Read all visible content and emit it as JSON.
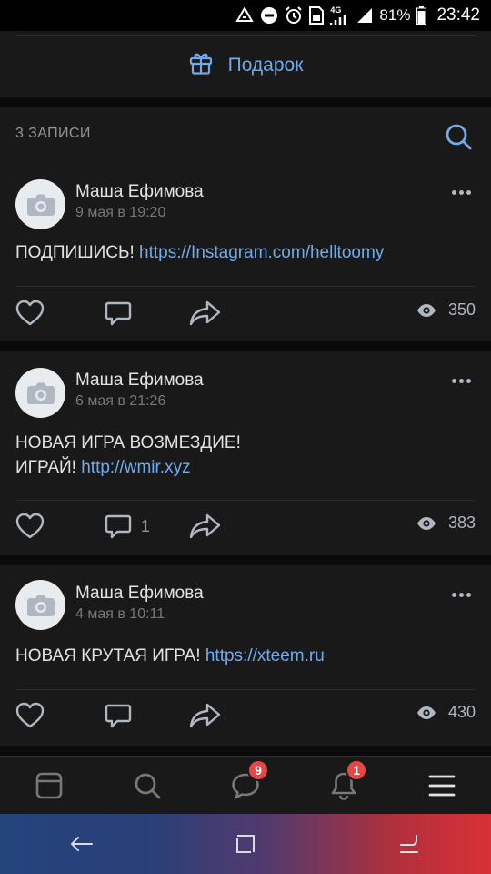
{
  "status_bar": {
    "battery_percent": "81%",
    "time": "23:42",
    "network": "4G",
    "icons": [
      "recycle-icon",
      "do-not-disturb-icon",
      "alarm-icon",
      "sim-icon",
      "signal-icon",
      "battery-icon"
    ]
  },
  "gift": {
    "label": "Подарок",
    "icon": "gift-icon"
  },
  "records": {
    "title": "3 ЗАПИСИ",
    "search_icon": "search-icon"
  },
  "posts": [
    {
      "author": "Маша Ефимова",
      "date": "9 мая в 19:20",
      "text_lines": [
        {
          "prefix": "ПОДПИШИСЬ! ",
          "link": "https://Instagram.com/helltoomy"
        }
      ],
      "comments": "",
      "views": "350"
    },
    {
      "author": "Маша Ефимова",
      "date": "6 мая в 21:26",
      "text_lines": [
        {
          "prefix": "НОВАЯ ИГРА ВОЗМЕЗДИЕ!",
          "link": ""
        },
        {
          "prefix": "ИГРАЙ! ",
          "link": "http://wmir.xyz"
        }
      ],
      "comments": "1",
      "views": "383"
    },
    {
      "author": "Маша Ефимова",
      "date": "4 мая в 10:11",
      "text_lines": [
        {
          "prefix": "НОВАЯ КРУТАЯ ИГРА! ",
          "link": "https://xteem.ru"
        }
      ],
      "comments": "",
      "views": "430"
    }
  ],
  "bottom_nav": {
    "messages_badge": "9",
    "notifications_badge": "1",
    "items": [
      "news-icon",
      "search-icon",
      "messages-icon",
      "notifications-icon",
      "menu-icon"
    ]
  },
  "colors": {
    "accent": "#71aaeb",
    "background": "#0a0a0a",
    "card": "#19191a",
    "badge": "#e64646"
  }
}
